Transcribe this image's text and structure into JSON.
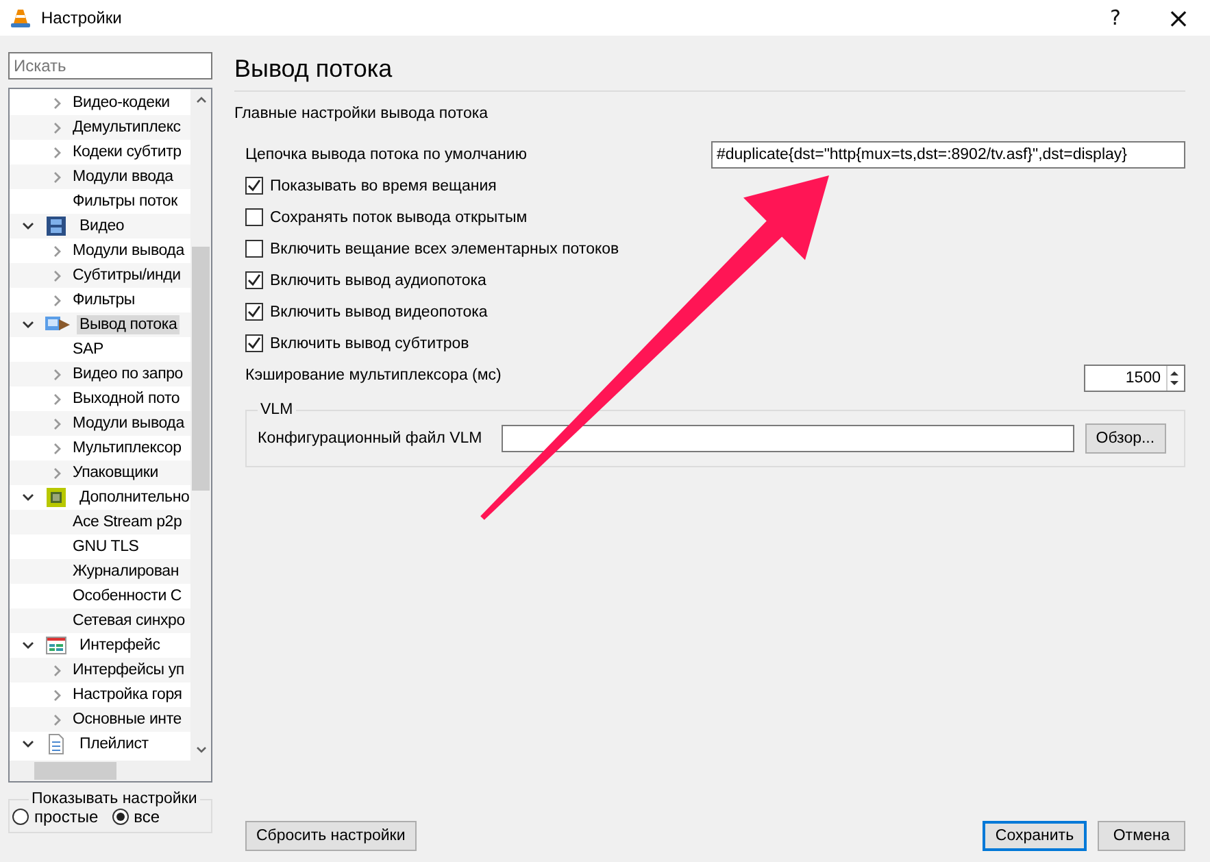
{
  "window": {
    "title": "Настройки",
    "help": "?",
    "close": "×"
  },
  "search": {
    "placeholder": "Искать"
  },
  "tree": {
    "continued_items": [
      {
        "label": "Видео-кодеки",
        "has_children": true,
        "selected": false
      },
      {
        "label": "Демультиплекс",
        "has_children": true,
        "selected": false
      },
      {
        "label": "Кодеки субтитр",
        "has_children": true,
        "selected": false
      },
      {
        "label": "Модули ввода",
        "has_children": true,
        "selected": false
      },
      {
        "label": "Фильтры поток",
        "has_children": false,
        "selected": false
      }
    ],
    "sections": [
      {
        "label": "Видео",
        "expanded": true,
        "selected": false,
        "children": [
          {
            "label": "Модули вывода",
            "has_children": true,
            "selected": false
          },
          {
            "label": "Субтитры/инди",
            "has_children": true,
            "selected": false
          },
          {
            "label": "Фильтры",
            "has_children": true,
            "selected": false
          }
        ]
      },
      {
        "label": "Вывод потока",
        "expanded": true,
        "selected": true,
        "children": [
          {
            "label": "SAP",
            "has_children": false,
            "selected": false
          },
          {
            "label": "Видео по запро",
            "has_children": true,
            "selected": false
          },
          {
            "label": "Выходной пото",
            "has_children": true,
            "selected": false
          },
          {
            "label": "Модули вывода",
            "has_children": true,
            "selected": false
          },
          {
            "label": "Мультиплексор",
            "has_children": true,
            "selected": false
          },
          {
            "label": "Упаковщики",
            "has_children": true,
            "selected": false
          }
        ]
      },
      {
        "label": "Дополнительно",
        "expanded": true,
        "selected": false,
        "children": [
          {
            "label": "Ace Stream p2p",
            "has_children": false,
            "selected": false
          },
          {
            "label": "GNU TLS",
            "has_children": false,
            "selected": false
          },
          {
            "label": "Журналирован",
            "has_children": false,
            "selected": false
          },
          {
            "label": "Особенности С",
            "has_children": false,
            "selected": false
          },
          {
            "label": "Сетевая синхро",
            "has_children": false,
            "selected": false
          }
        ]
      },
      {
        "label": "Интерфейс",
        "expanded": true,
        "selected": false,
        "children": [
          {
            "label": "Интерфейсы уп",
            "has_children": true,
            "selected": false
          },
          {
            "label": "Настройка горя",
            "has_children": true,
            "selected": false
          },
          {
            "label": "Основные инте",
            "has_children": true,
            "selected": false
          }
        ]
      },
      {
        "label": "Плейлист",
        "expanded": true,
        "selected": false
      }
    ]
  },
  "show_settings": {
    "title": "Показывать настройки",
    "options": [
      {
        "label": "простые",
        "selected": false
      },
      {
        "label": "все",
        "selected": true
      }
    ]
  },
  "page": {
    "title": "Вывод потока",
    "subtitle": "Главные настройки вывода потока",
    "settings": [
      {
        "kind": "text",
        "label": "Цепочка вывода потока по умолчанию",
        "value": "#duplicate{dst=\"http{mux=ts,dst=:8902/tv.asf}\",dst=display}"
      },
      {
        "kind": "checkbox",
        "label": "Показывать во время вещания",
        "checked": true
      },
      {
        "kind": "checkbox",
        "label": "Сохранять поток вывода открытым",
        "checked": false
      },
      {
        "kind": "checkbox",
        "label": "Включить вещание всех элементарных потоков",
        "checked": false
      },
      {
        "kind": "checkbox",
        "label": "Включить вывод аудиопотока",
        "checked": true
      },
      {
        "kind": "checkbox",
        "label": "Включить вывод видеопотока",
        "checked": true
      },
      {
        "kind": "checkbox",
        "label": "Включить вывод субтитров",
        "checked": true
      },
      {
        "kind": "spin",
        "label": "Кэширование мультиплексора (мс)",
        "value": "1500"
      }
    ],
    "vlm": {
      "title": "VLM",
      "label": "Конфигурационный файл VLM",
      "button": "Обзор..."
    }
  },
  "buttons": {
    "reset": "Сбросить настройки",
    "save": "Сохранить",
    "cancel": "Отмена"
  }
}
